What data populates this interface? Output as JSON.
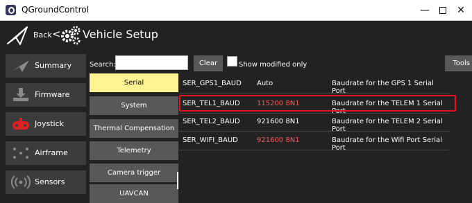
{
  "window": {
    "title": "QGroundControl",
    "minimize": "—",
    "maximize": "",
    "close": "✕"
  },
  "toolbar": {
    "back_label": "Back",
    "back_chevron": "<",
    "title": "Vehicle Setup"
  },
  "sidebar": {
    "items": [
      {
        "label": "Summary",
        "icon": "summary-plane-icon"
      },
      {
        "label": "Firmware",
        "icon": "firmware-download-icon"
      },
      {
        "label": "Joystick",
        "icon": "joystick-icon"
      },
      {
        "label": "Airframe",
        "icon": "airframe-icon"
      },
      {
        "label": "Sensors",
        "icon": "sensors-icon"
      }
    ]
  },
  "search": {
    "label": "Search:",
    "value": "",
    "placeholder": ""
  },
  "buttons": {
    "clear": "Clear",
    "tools": "Tools"
  },
  "filter": {
    "show_modified_label": "Show modified only",
    "checked": false
  },
  "groups": {
    "active_index": 0,
    "items": [
      "Serial",
      "System",
      "Thermal Compensation",
      "Telemetry",
      "Camera trigger",
      "UAVCAN"
    ]
  },
  "parameters": [
    {
      "name": "SER_GPS1_BAUD",
      "value": "Auto",
      "description": "Baudrate for the GPS 1 Serial Port",
      "modified": false
    },
    {
      "name": "SER_TEL1_BAUD",
      "value": "115200 8N1",
      "description": "Baudrate for the TELEM 1 Serial Port",
      "modified": true
    },
    {
      "name": "SER_TEL2_BAUD",
      "value": "921600 8N1",
      "description": "Baudrate for the TELEM 2 Serial Port",
      "modified": false
    },
    {
      "name": "SER_WIFI_BAUD",
      "value": "921600 8N1",
      "description": "Baudrate for the Wifi Port Serial Port",
      "modified": true
    }
  ],
  "colors": {
    "background": "#222222",
    "button": "#585858",
    "active_group": "#fff291",
    "modified_value": "#f55a5a",
    "highlight": "#e81123"
  }
}
